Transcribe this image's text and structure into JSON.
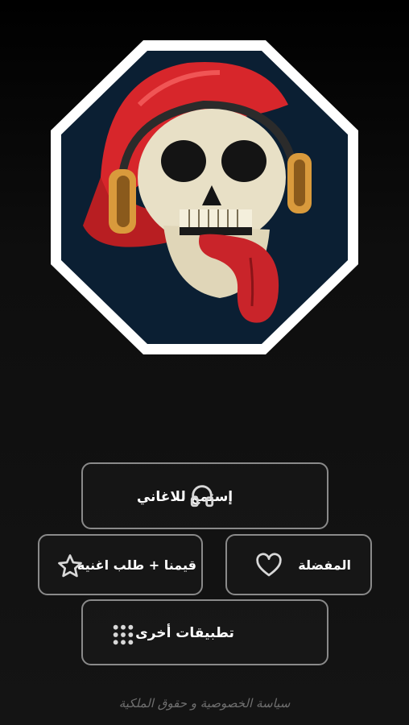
{
  "logo": {
    "icon": "skull-with-red-cap-and-headphones",
    "colors": {
      "frame": "#ffffff",
      "background": "#0b1f33",
      "cap": "#d7262b",
      "tongue": "#c9242a",
      "bone": "#e8e0c6",
      "headphones": "#d99a3c"
    }
  },
  "buttons": {
    "listen": {
      "label": "إستمع للاغاني",
      "icon": "headphones-icon"
    },
    "rate": {
      "label": "قيمنا + طلب اغنيه",
      "icon": "star-icon"
    },
    "favorite": {
      "label": "المفضلة",
      "icon": "heart-icon"
    },
    "other_apps": {
      "label": "تطبيقات أخرى",
      "icon": "grid-dots-icon"
    }
  },
  "footer": {
    "privacy_label": "سياسة الخصوصية و حقوق الملكية"
  },
  "theme": {
    "border": "#8a8a8a",
    "text": "#ffffff",
    "muted": "#6f6f6f"
  }
}
